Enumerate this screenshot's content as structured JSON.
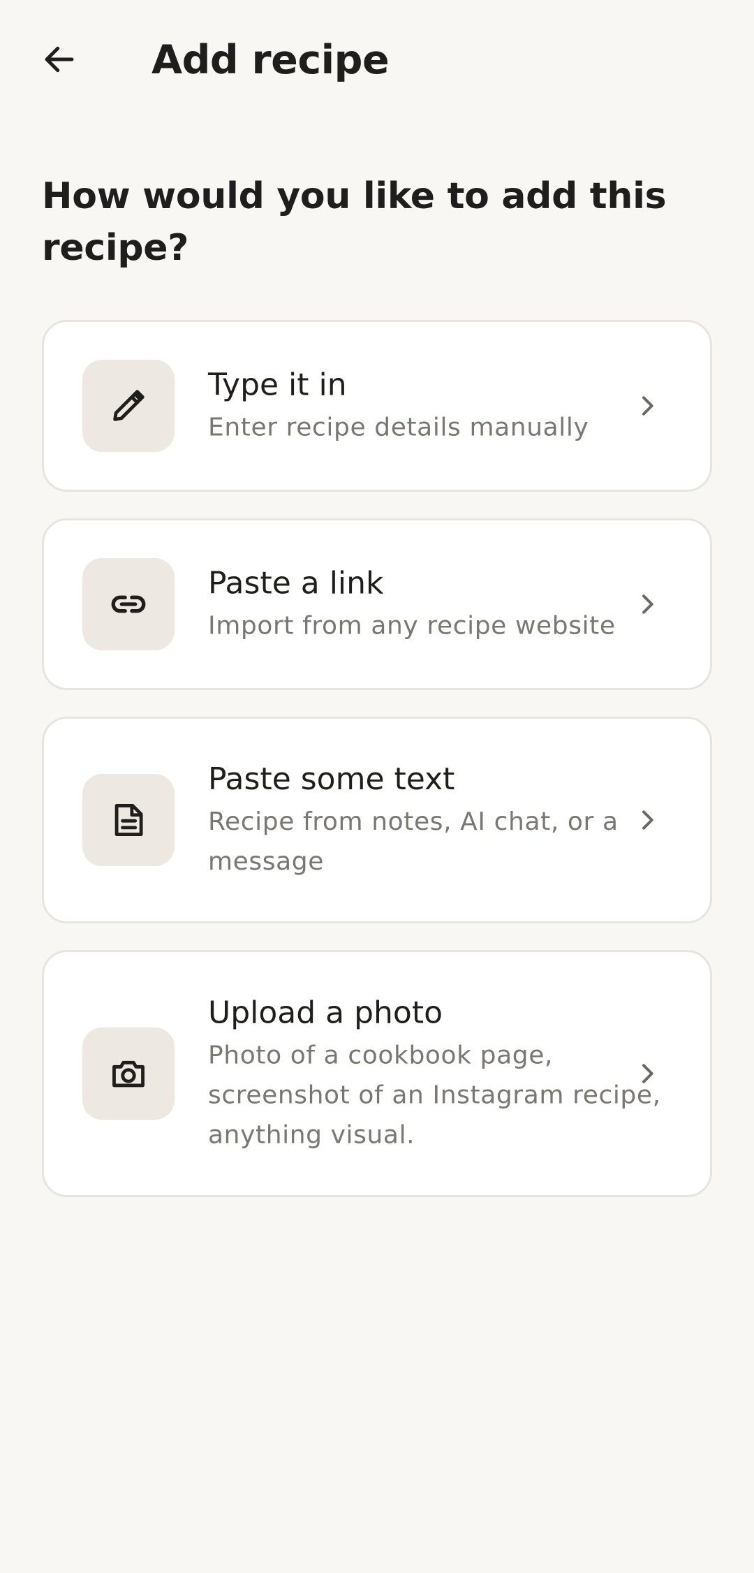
{
  "header": {
    "title": "Add recipe",
    "back_icon": "arrow-left-icon"
  },
  "question": "How would you like to add this recipe?",
  "options": [
    {
      "title": "Type it in",
      "description": "Enter recipe details manually",
      "icon": "pencil-icon"
    },
    {
      "title": "Paste a link",
      "description": "Import from any recipe website",
      "icon": "link-icon"
    },
    {
      "title": "Paste some text",
      "description": "Recipe from notes, AI chat, or a message",
      "icon": "document-icon"
    },
    {
      "title": "Upload a photo",
      "description": "Photo of a cookbook page, screenshot of an Instagram recipe, anything visual.",
      "icon": "camera-icon"
    }
  ],
  "colors": {
    "background": "#f8f7f4",
    "card": "#ffffff",
    "card_border": "#e8e5e0",
    "icon_tile": "#ede9e2",
    "text_primary": "#1f1e1c",
    "text_secondary": "#7a7773"
  }
}
